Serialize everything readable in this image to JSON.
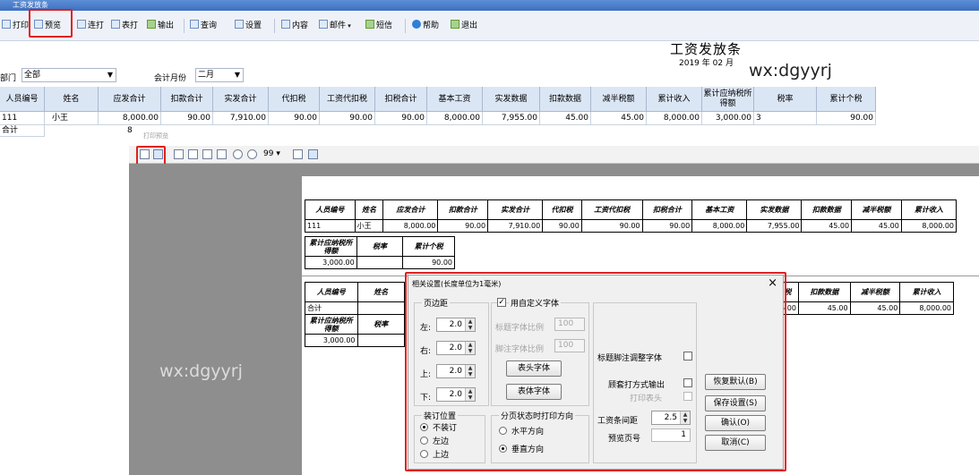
{
  "window": {
    "title": "工资发放条"
  },
  "toolbar": {
    "print": "打印",
    "preview": "预览",
    "continuous_print": "连打",
    "table_print": "表打",
    "output": "输出",
    "query": "查询",
    "settings": "设置",
    "content": "内容",
    "mail": "邮件",
    "sms": "短信",
    "help": "帮助",
    "exit": "退出"
  },
  "report": {
    "title": "工资发放条",
    "date": "2019 年 02 月"
  },
  "watermark": "wx:dgyyrj",
  "filters": {
    "dept_label": "部门",
    "dept_value": "全部",
    "month_label": "会计月份",
    "month_value": "二月"
  },
  "grid": {
    "headers": [
      "人员编号",
      "姓名",
      "应发合计",
      "扣款合计",
      "实发合计",
      "代扣税",
      "工资代扣税",
      "扣税合计",
      "基本工资",
      "实发数据",
      "扣款数据",
      "减半税额",
      "累计收入",
      "累计应纳税所得额",
      "税率",
      "累计个税"
    ],
    "row1": [
      "111",
      "小王",
      "8,000.00",
      "90.00",
      "7,910.00",
      "90.00",
      "90.00",
      "90.00",
      "8,000.00",
      "7,955.00",
      "45.00",
      "45.00",
      "8,000.00",
      "3,000.00",
      "3",
      "90.00"
    ],
    "row2": [
      "合计",
      "8"
    ]
  },
  "preview": {
    "window_title": "打印预览",
    "zoom_value": "99",
    "table1": {
      "headers": [
        "人员编号",
        "姓名",
        "应发合计",
        "扣款合计",
        "实发合计",
        "代扣税",
        "工资代扣税",
        "扣税合计",
        "基本工资",
        "实发数据",
        "扣款数据",
        "减半税额",
        "累计收入"
      ],
      "row": [
        "111",
        "小王",
        "8,000.00",
        "90.00",
        "7,910.00",
        "90.00",
        "90.00",
        "90.00",
        "8,000.00",
        "7,955.00",
        "45.00",
        "45.00",
        "8,000.00"
      ],
      "headers2": [
        "累计应纳税所得额",
        "税率",
        "累计个税"
      ],
      "row2": [
        "3,000.00",
        "",
        "90.00"
      ]
    },
    "table2": {
      "headers": [
        "人员编号",
        "姓名"
      ],
      "row": [
        "合计",
        ""
      ],
      "headers2": [
        "累计应纳税所得额",
        "税率"
      ],
      "row2": [
        "3,000.00",
        ""
      ],
      "right_headers": [
        "税",
        "扣款数据",
        "减半税额",
        "累计收入"
      ],
      "right_row": [
        "5.00",
        "45.00",
        "45.00",
        "8,000.00"
      ]
    }
  },
  "dialog": {
    "title": "相关设置(长度单位为1毫米)",
    "margins_group": "页边距",
    "left_label": "左:",
    "left_value": "2.0",
    "right_label": "右:",
    "right_value": "2.0",
    "top_label": "上:",
    "top_value": "2.0",
    "bottom_label": "下:",
    "bottom_value": "2.0",
    "custom_font_label": "用自定义字体",
    "title_font_ratio_label": "标题字体比例",
    "title_font_ratio_value": "100",
    "footnote_font_ratio_label": "脚注字体比例",
    "footnote_font_ratio_value": "100",
    "header_font_button": "表头字体",
    "body_font_button": "表体字体",
    "title_footnote_adjust_label": "标题脚注调整字体",
    "sleeve_print_label": "顾套打方式输出",
    "print_header_label": "打印表头",
    "row_spacing_label": "工资条间距",
    "row_spacing_value": "2.5",
    "preview_page_label": "预览页号",
    "preview_page_value": "1",
    "binding_group": "装订位置",
    "bind_none": "不装订",
    "bind_left": "左边",
    "bind_top": "上边",
    "direction_group": "分页状态时打印方向",
    "dir_horizontal": "水平方向",
    "dir_vertical": "垂直方向",
    "restore_default_button": "恢复默认(B)",
    "save_settings_button": "保存设置(S)",
    "confirm_button": "确认(O)",
    "cancel_button": "取消(C)"
  }
}
